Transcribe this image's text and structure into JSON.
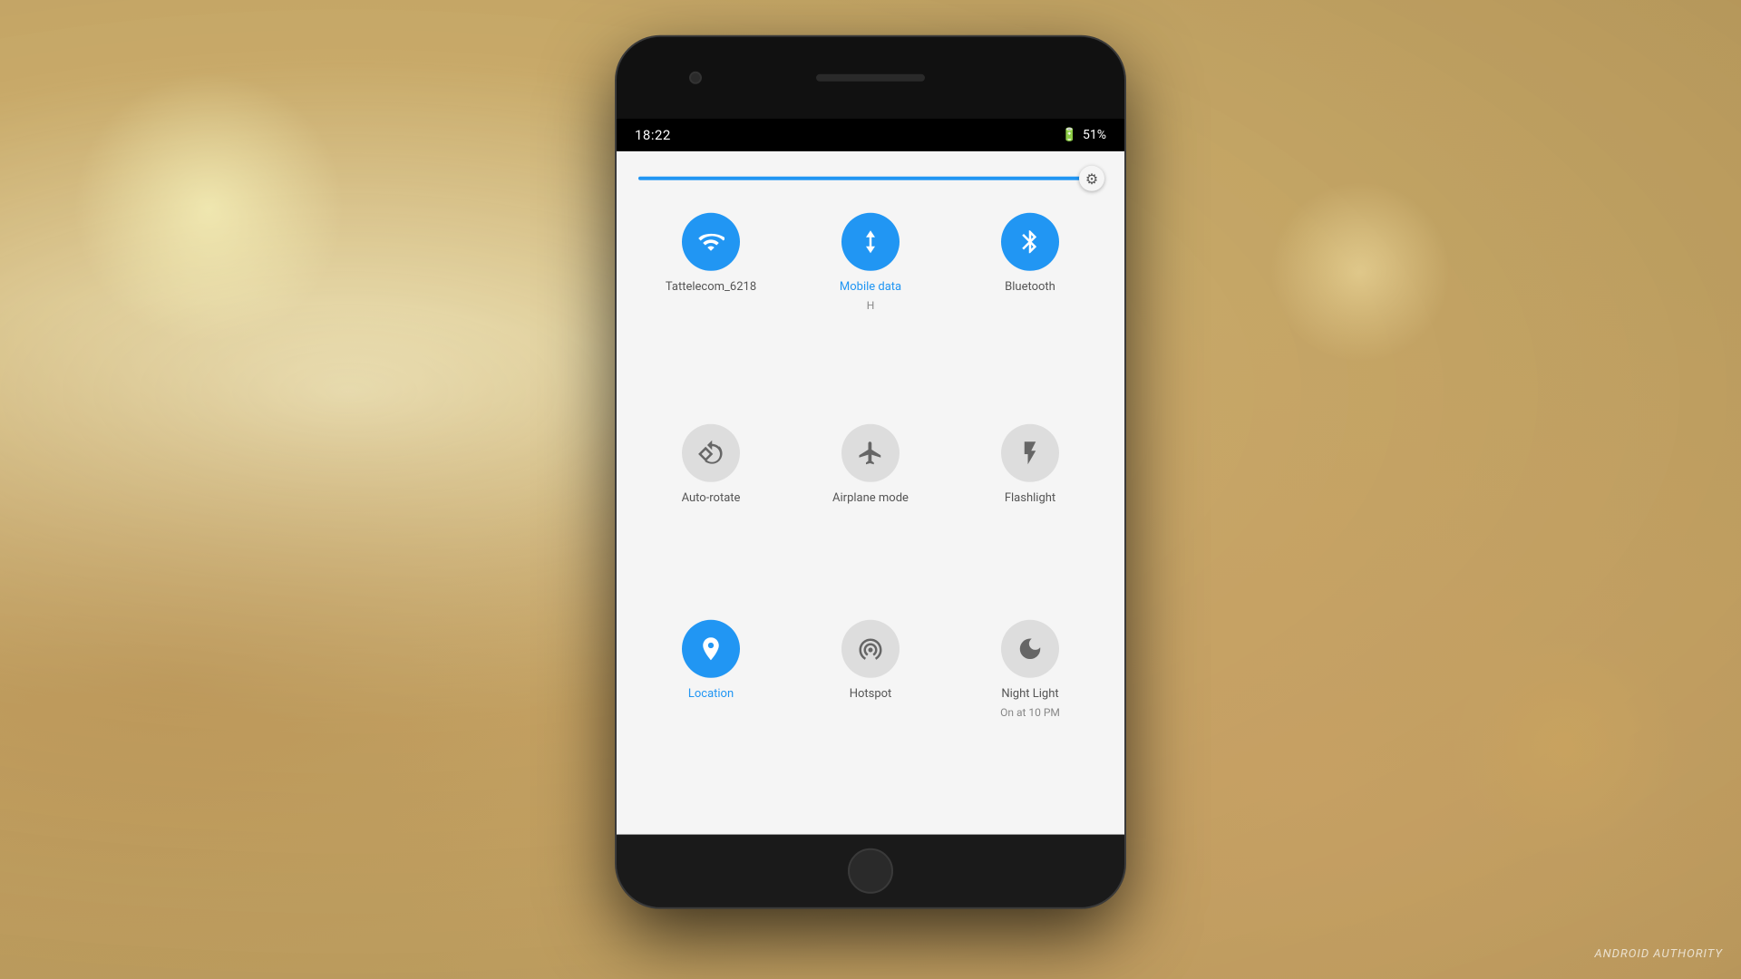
{
  "background": {
    "color": "#c8a96e"
  },
  "watermark": {
    "text": "ANDROID AUTHORITY"
  },
  "phone": {
    "status_bar": {
      "time": "18:22",
      "battery_percent": "51%"
    },
    "quick_settings": {
      "brightness_value": 85,
      "tiles": [
        {
          "id": "wifi",
          "label": "Tattelecom_6218",
          "sublabel": "",
          "active": true,
          "icon": "wifi"
        },
        {
          "id": "mobile-data",
          "label": "Mobile data",
          "sublabel": "H",
          "active": true,
          "icon": "mobile-data"
        },
        {
          "id": "bluetooth",
          "label": "Bluetooth",
          "sublabel": "",
          "active": true,
          "icon": "bluetooth"
        },
        {
          "id": "auto-rotate",
          "label": "Auto-rotate",
          "sublabel": "",
          "active": false,
          "icon": "rotate"
        },
        {
          "id": "airplane-mode",
          "label": "Airplane mode",
          "sublabel": "",
          "active": false,
          "icon": "airplane"
        },
        {
          "id": "flashlight",
          "label": "Flashlight",
          "sublabel": "",
          "active": false,
          "icon": "flashlight"
        },
        {
          "id": "location",
          "label": "Location",
          "sublabel": "",
          "active": true,
          "icon": "location"
        },
        {
          "id": "hotspot",
          "label": "Hotspot",
          "sublabel": "",
          "active": false,
          "icon": "hotspot"
        },
        {
          "id": "night-light",
          "label": "Night Light",
          "sublabel": "On at 10 PM",
          "active": false,
          "icon": "moon"
        }
      ]
    }
  }
}
